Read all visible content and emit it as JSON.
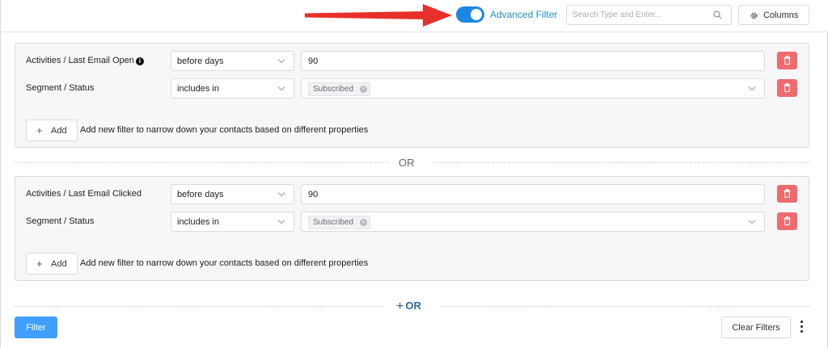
{
  "header": {
    "advanced_filter": {
      "label": "Advanced Filter",
      "enabled": true
    },
    "search": {
      "placeholder": "Search Type and Enter...",
      "value": ""
    },
    "columns_label": "Columns"
  },
  "colors": {
    "accent": "#1e87e5",
    "advanced_label": "#1e8dc8",
    "delete": "#ee6b6e",
    "primary_button": "#409eff",
    "arrow": "#e8302a",
    "or_button": "#2d6b97"
  },
  "groups": [
    {
      "rows": [
        {
          "label": "Activities / Last Email Open",
          "has_info_icon": true,
          "operator": "before days",
          "value": "90"
        },
        {
          "label": "Segment / Status",
          "has_info_icon": false,
          "operator": "includes in",
          "tags": [
            "Subscribed"
          ]
        }
      ],
      "add_label": "Add",
      "add_hint": "Add new filter to narrow down your contacts based on different properties"
    },
    {
      "rows": [
        {
          "label": "Activities / Last Email Clicked",
          "has_info_icon": false,
          "operator": "before days",
          "value": "90"
        },
        {
          "label": "Segment / Status",
          "has_info_icon": false,
          "operator": "includes in",
          "tags": [
            "Subscribed"
          ]
        }
      ],
      "add_label": "Add",
      "add_hint": "Add new filter to narrow down your contacts based on different properties"
    }
  ],
  "or_separator": "OR",
  "add_or_label": "OR",
  "actions": {
    "filter_label": "Filter",
    "clear_label": "Clear Filters"
  }
}
